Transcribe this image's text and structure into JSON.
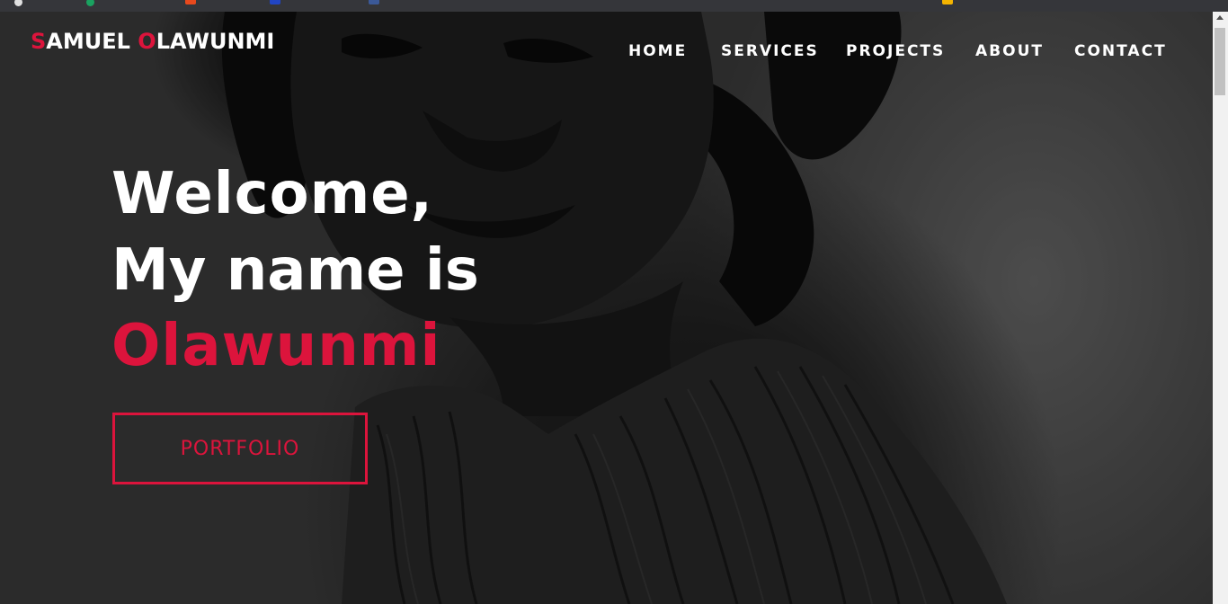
{
  "site": {
    "brand_first_initial": "S",
    "brand_first_rest": "AMUEL ",
    "brand_last_initial": "O",
    "brand_last_rest": "LAWUNMI"
  },
  "nav": {
    "items": [
      {
        "label": "HOME"
      },
      {
        "label": "SERVICES"
      },
      {
        "label": "PROJECTS"
      },
      {
        "label": "ABOUT"
      },
      {
        "label": "CONTACT"
      }
    ]
  },
  "hero": {
    "line1": "Welcome,",
    "line2": "My name is",
    "line3": "Olawunmi",
    "button_label": "PORTFOLIO"
  },
  "colors": {
    "accent": "#dc143c",
    "text": "#ffffff",
    "browser_strip": "#35363a"
  }
}
